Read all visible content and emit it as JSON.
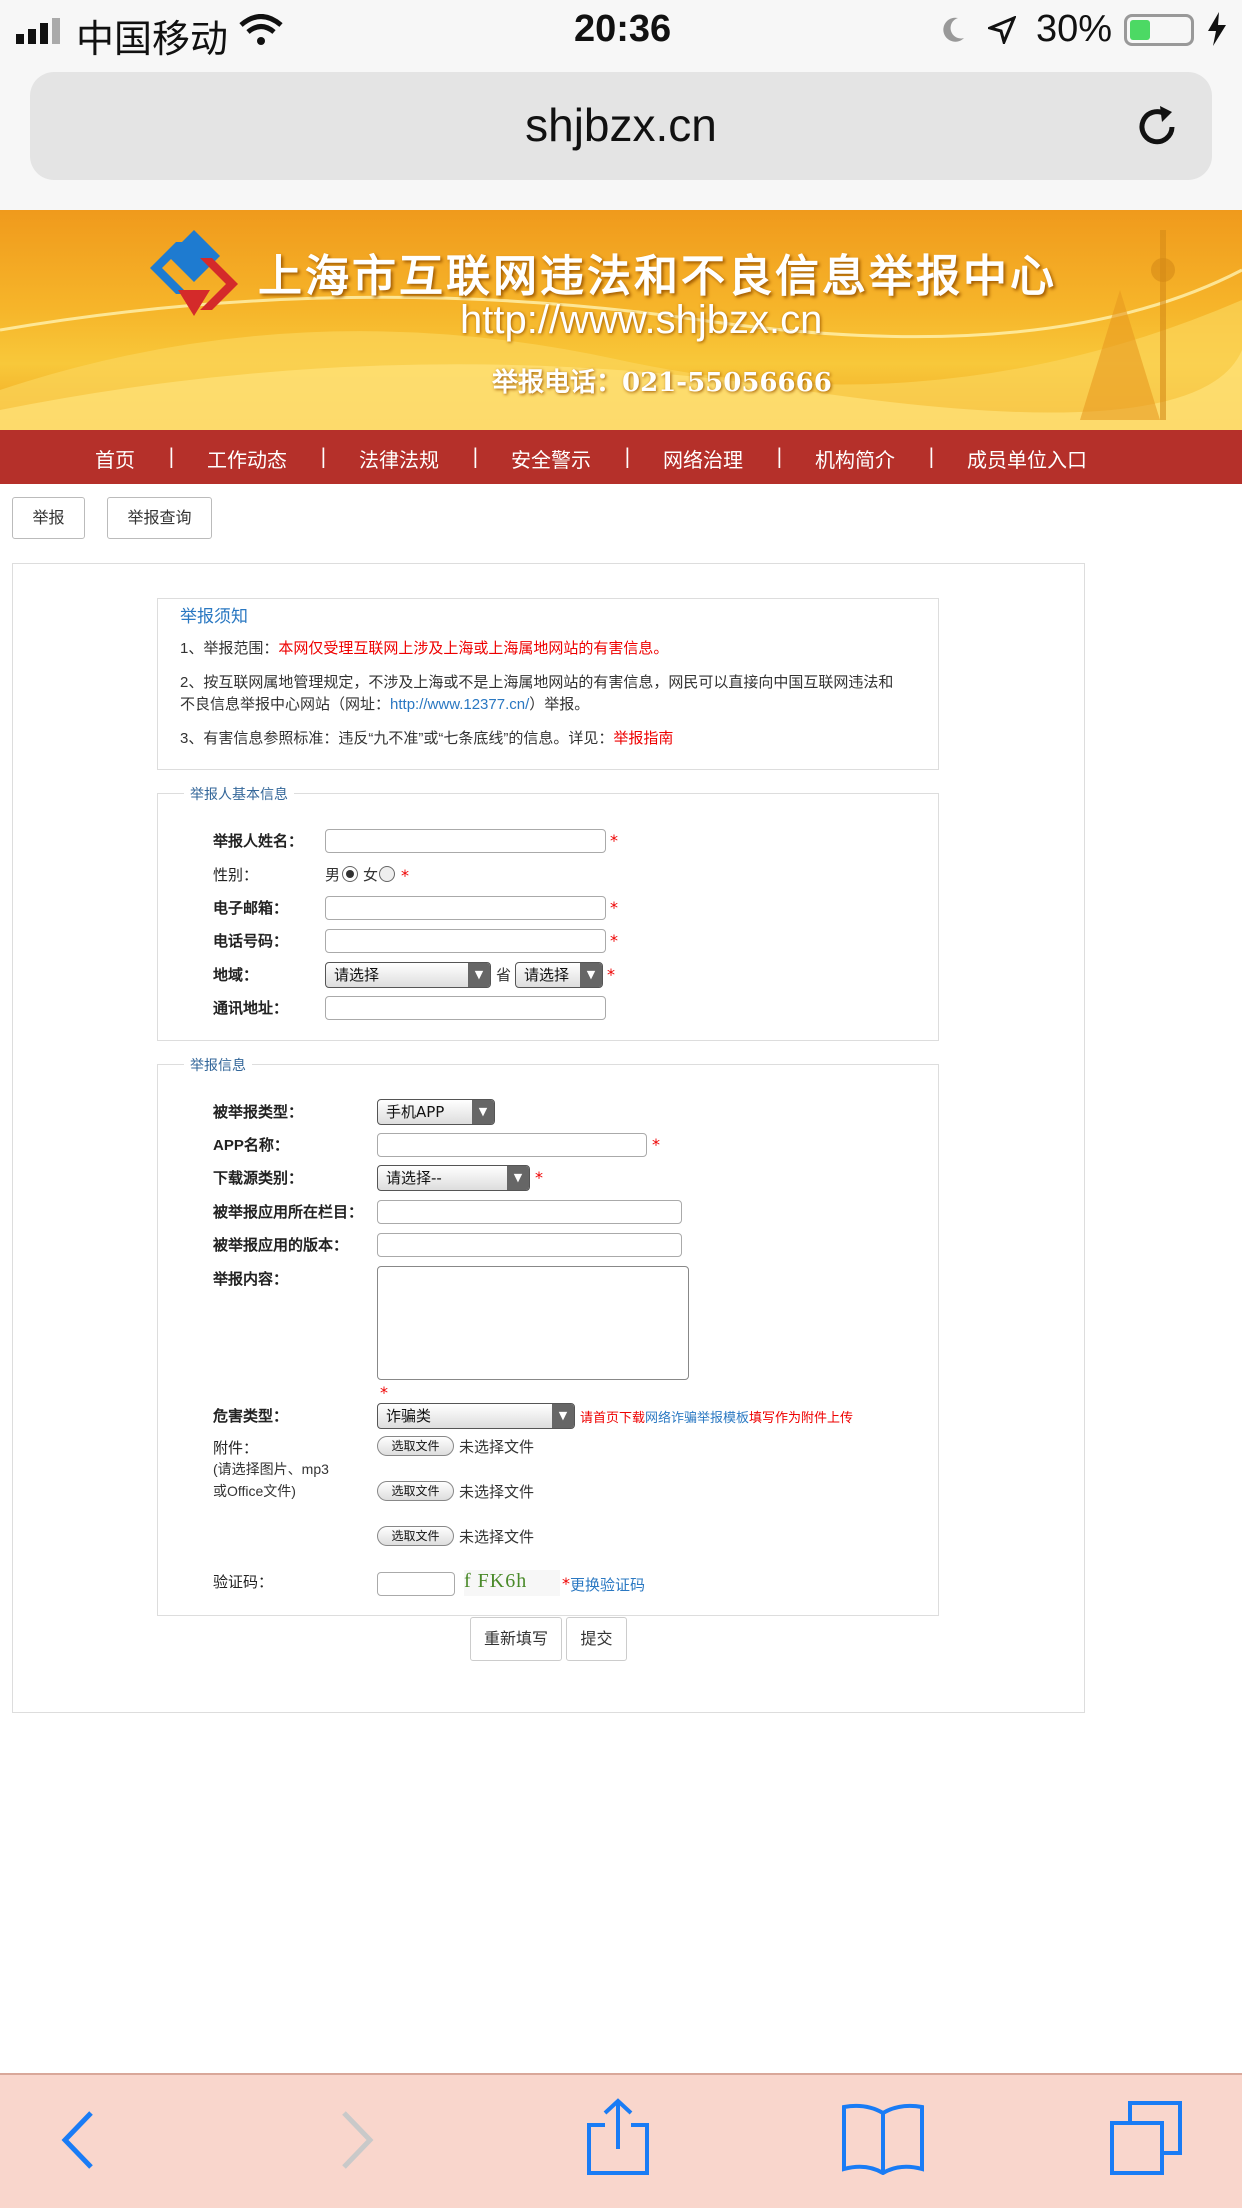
{
  "status_bar": {
    "carrier": "中国移动",
    "time": "20:36",
    "battery": "30%"
  },
  "browser": {
    "url": "shjbzx.cn"
  },
  "banner": {
    "title": "上海市互联网违法和不良信息举报中心",
    "url": "http://www.shjbzx.cn",
    "phone": "举报电话：021-55056666"
  },
  "nav": {
    "items": [
      "首页",
      "工作动态",
      "法律法规",
      "安全警示",
      "网络治理",
      "机构简介",
      "成员单位入口"
    ]
  },
  "tabs": {
    "report": "举报",
    "query": "举报查询"
  },
  "notice": {
    "title": "举报须知",
    "line1_prefix": "1、举报范围：",
    "line1_red": "本网仅受理互联网上涉及上海或上海属地网站的有害信息。",
    "line2a": "2、按互联网属地管理规定，不涉及上海或不是上海属地网站的有害信息，网民可以直接向中国互联网违法和",
    "line2b_prefix": "不良信息举报中心网站（网址：",
    "line2b_link": "http://www.12377.cn/",
    "line2b_suffix": "）举报。",
    "line3_prefix": "3、有害信息参照标准：违反“九不准”或“七条底线”的信息。详见：",
    "line3_link": "举报指南"
  },
  "reporter": {
    "legend": "举报人基本信息",
    "name_label": "举报人姓名：",
    "gender_label": "性别：",
    "male": "男",
    "female": "女",
    "email_label": "电子邮箱：",
    "phone_label": "电话号码：",
    "region_label": "地域：",
    "province_select": "请选择",
    "province_unit": "省",
    "city_select": "请选择",
    "address_label": "通讯地址：",
    "required_mark": "*"
  },
  "report": {
    "legend": "举报信息",
    "type_label": "被举报类型：",
    "type_value": "手机APP",
    "app_name_label": "APP名称：",
    "source_label": "下载源类别：",
    "source_value": "请选择--",
    "column_label": "被举报应用所在栏目：",
    "version_label": "被举报应用的版本：",
    "content_label": "举报内容：",
    "harm_label": "危害类型：",
    "harm_value": "诈骗类",
    "harm_hint_a": "请首页下载",
    "harm_hint_link": "网络诈骗举报模板",
    "harm_hint_b": "填写作为附件上传",
    "attach_label": "附件：",
    "attach_hint1": "(请选择图片、mp3",
    "attach_hint2": "或Office文件)",
    "file_button": "选取文件",
    "file_none": "未选择文件",
    "captcha_label": "验证码：",
    "captcha_image_text": "f FK6h",
    "captcha_refresh": "更换验证码"
  },
  "actions": {
    "reset": "重新填写",
    "submit": "提交"
  },
  "toolbar": {
    "back": "back-icon",
    "forward": "forward-icon",
    "share": "share-icon",
    "bookmarks": "bookmarks-icon",
    "tabs": "tabs-icon"
  }
}
